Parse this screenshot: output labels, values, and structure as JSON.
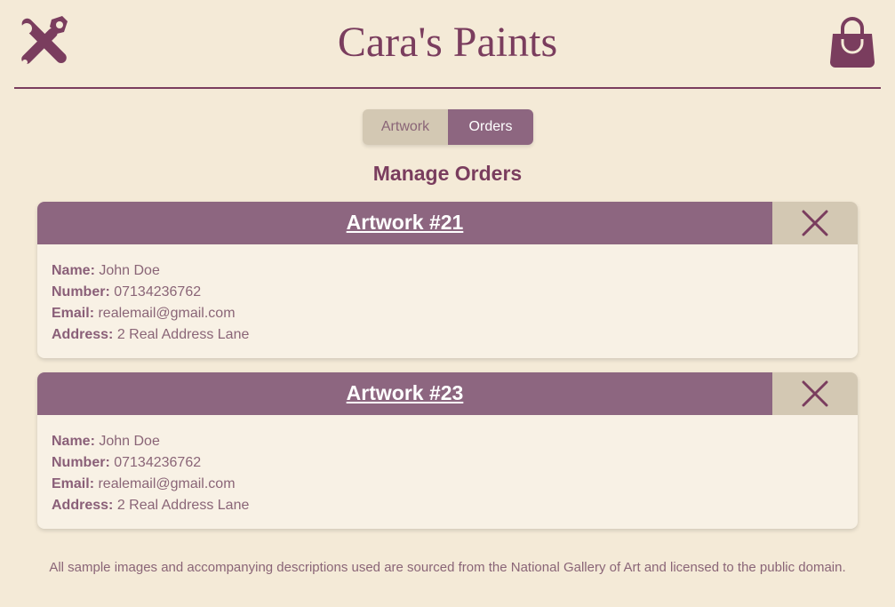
{
  "brand": {
    "title": "Cara's Paints"
  },
  "icons": {
    "left": "tools-icon",
    "right": "shopping-bag-icon",
    "close": "close-icon"
  },
  "tabs": [
    {
      "label": "Artwork",
      "active": false
    },
    {
      "label": "Orders",
      "active": true
    }
  ],
  "page_title": "Manage Orders",
  "orders": [
    {
      "title": "Artwork #21",
      "fields": [
        {
          "label": "Name:",
          "value": "John Doe"
        },
        {
          "label": "Number:",
          "value": "07134236762"
        },
        {
          "label": "Email:",
          "value": "realemail@gmail.com"
        },
        {
          "label": "Address:",
          "value": "2 Real Address Lane"
        }
      ]
    },
    {
      "title": "Artwork #23",
      "fields": [
        {
          "label": "Name:",
          "value": "John Doe"
        },
        {
          "label": "Number:",
          "value": "07134236762"
        },
        {
          "label": "Email:",
          "value": "realemail@gmail.com"
        },
        {
          "label": "Address:",
          "value": "2 Real Address Lane"
        }
      ]
    }
  ],
  "footer": "All sample images and accompanying descriptions used are sourced from the National Gallery of Art and licensed to the public domain.",
  "colors": {
    "background": "#f4ead7",
    "brand": "#7a3d5e",
    "header_bar": "#8d6680",
    "close_bar": "#d3c8b3",
    "card": "#f8f1e5"
  }
}
